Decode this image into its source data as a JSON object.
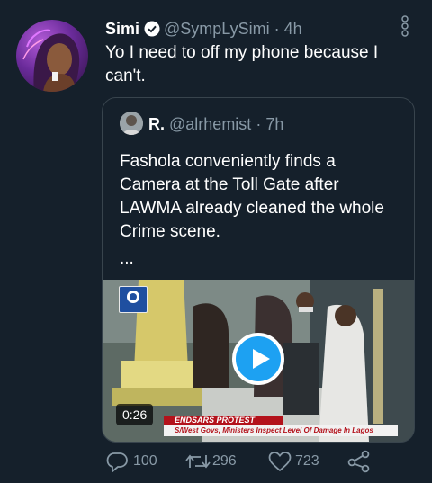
{
  "tweet": {
    "author_name": "Simi",
    "author_handle": "@SympLySimi",
    "separator": "·",
    "time": "4h",
    "text": "Yo I need to off my phone because I can't."
  },
  "quoted_tweet": {
    "author_name": "R.",
    "author_handle": "@alrhemist",
    "separator": "·",
    "time": "7h",
    "text": "Fashola conveniently finds a Camera at the Toll Gate after LAWMA already cleaned the whole Crime scene.",
    "ellipsis": "...",
    "video": {
      "duration": "0:26",
      "lower_third_title": "ENDSARS PROTEST AFTERMATH",
      "lower_third_subtitle": "S/West Govs, Ministers Inspect Level Of Damage In Lagos",
      "channel_logo_text": "CHANNELS"
    }
  },
  "actions": {
    "reply_count": "100",
    "retweet_count": "296",
    "like_count": "723"
  },
  "colors": {
    "background": "#15202b",
    "muted": "#8899a6",
    "accent": "#1da1f2",
    "border": "#38444d"
  },
  "icons": [
    "verified-badge-icon",
    "more-options-icon",
    "play-icon",
    "reply-icon",
    "retweet-icon",
    "like-icon",
    "share-icon"
  ]
}
